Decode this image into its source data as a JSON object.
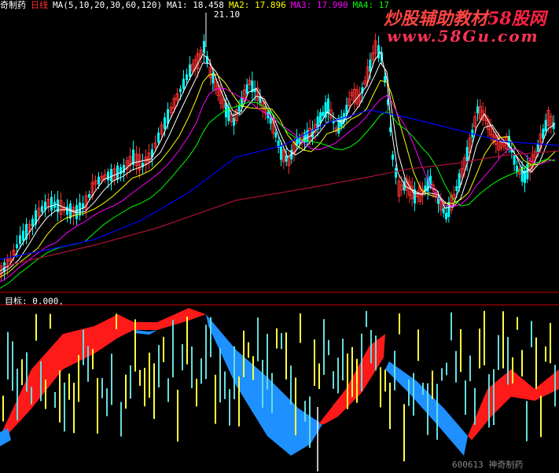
{
  "header": {
    "stock_name": "奇制药",
    "period": "日线",
    "ma_params": "MA(5,10,20,30,60,120)",
    "ma1": "MA1: 18.458",
    "ma2": "MA2: 17.896",
    "ma3": "MA3: 17.990",
    "ma4": "MA4: 17"
  },
  "price_annotation": "21.10",
  "watermark": {
    "cn": "炒股辅助教材",
    "brand": "58股网",
    "url": "www.58Gu.com"
  },
  "indicator": {
    "label": "目标: 0.000,"
  },
  "footer": {
    "code": "600613",
    "name": "神奇制药"
  },
  "colors": {
    "bg": "#000000",
    "up_candle": "#ff3030",
    "down_candle": "#00ffff",
    "ma_white": "#ffffff",
    "ma_yellow": "#ffff00",
    "ma_magenta": "#ff00ff",
    "ma_green": "#00ff00",
    "ma_blue": "#0000ff",
    "ma_maroon": "#aa1133",
    "red_ribbon": "#ff1a1a",
    "blue_ribbon": "#1e90ff",
    "yellow_bar": "#ffff40",
    "cyan_bar": "#66dddd",
    "separator": "#cc0000"
  }
}
